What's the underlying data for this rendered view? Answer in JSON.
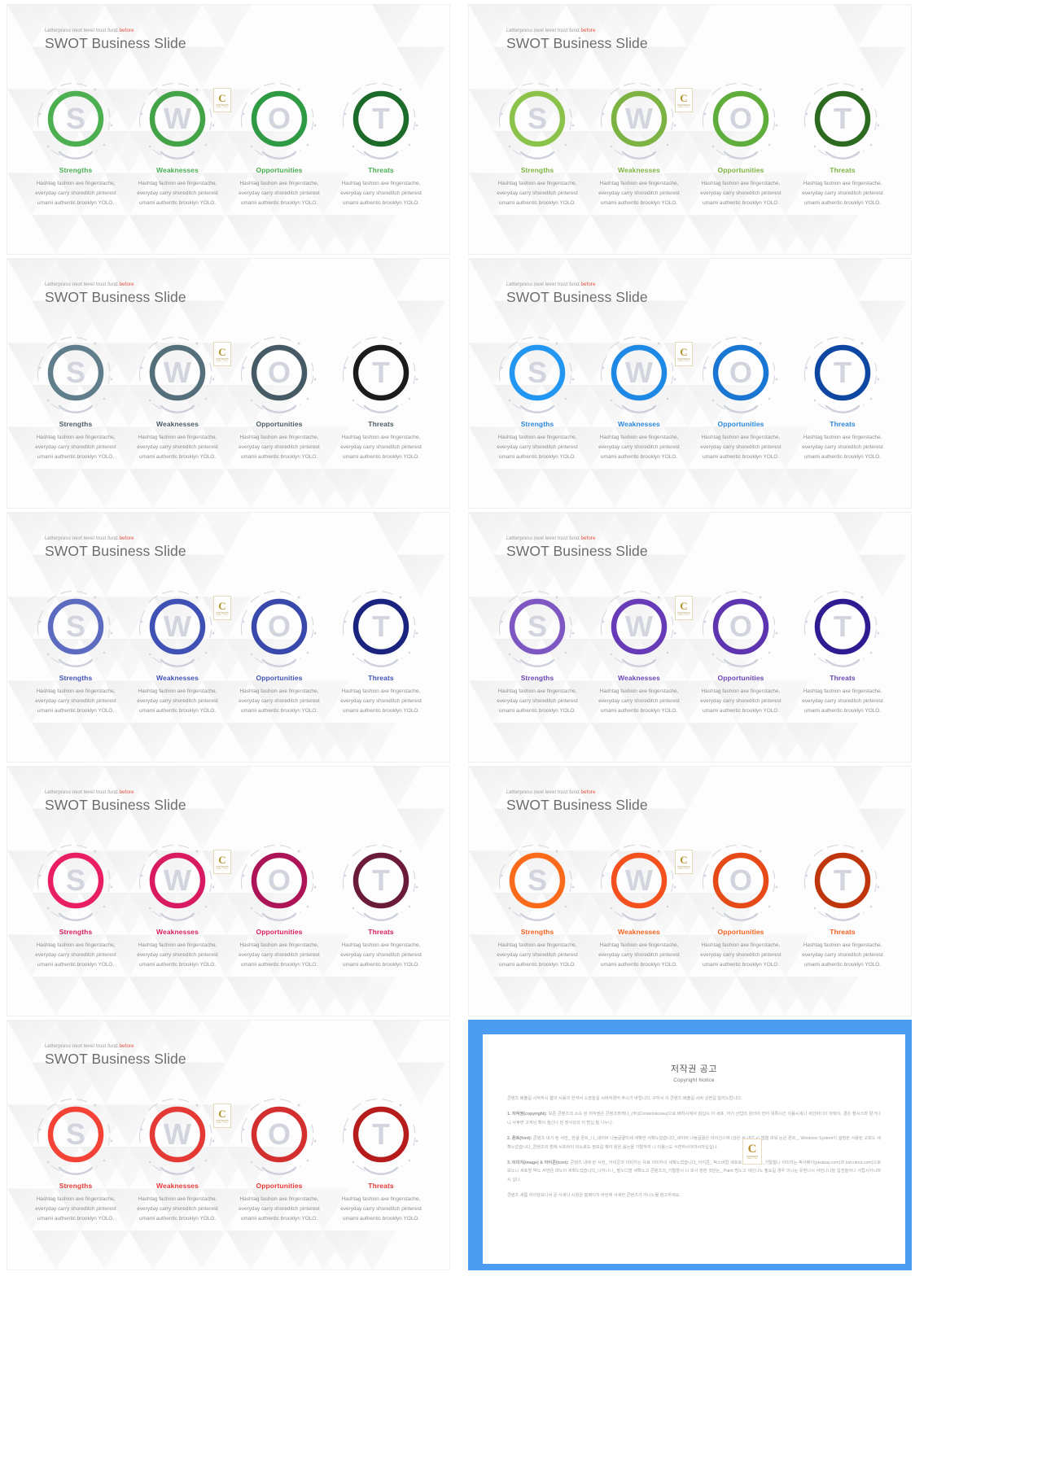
{
  "slide": {
    "kicker_prefix": "Letterpress next level trust fund.",
    "kicker_accent": "before",
    "title": "SWOT Business Slide"
  },
  "swot_items": [
    {
      "letter": "S",
      "category": "Strengths",
      "desc": "Hashtag fashion axe fingerstache, everyday carry shoreditch pinterest umami authentic brooklyn YOLO."
    },
    {
      "letter": "W",
      "category": "Weaknesses",
      "desc": "Hashtag fashion axe fingerstache, everyday carry shoreditch pinterest umami authentic brooklyn YOLO."
    },
    {
      "letter": "O",
      "category": "Opportunities",
      "desc": "Hashtag fashion axe fingerstache, everyday carry shoreditch pinterest umami authentic brooklyn YOLO."
    },
    {
      "letter": "T",
      "category": "Threats",
      "desc": "Hashtag fashion axe fingerstache, everyday carry shoreditch pinterest umami authentic brooklyn YOLO."
    }
  ],
  "watermark": {
    "letter": "C",
    "line1": "CONTENTS",
    "line2": "MALL.COM"
  },
  "themes": [
    {
      "name": "green",
      "ring": [
        "#4caf50",
        "#43a347",
        "#2e9b44",
        "#1d6b2a"
      ],
      "label": "#46ad4f"
    },
    {
      "name": "lime-green",
      "ring": [
        "#8bc34a",
        "#7cb342",
        "#5fae3c",
        "#2c6b1f"
      ],
      "label": "#7cb342"
    },
    {
      "name": "slate-gray",
      "ring": [
        "#607d8b",
        "#546e7a",
        "#455a64",
        "#1b1b1b"
      ],
      "label": "#4a5b64"
    },
    {
      "name": "blue",
      "ring": [
        "#2196f3",
        "#1e88e5",
        "#1976d2",
        "#0d47a1"
      ],
      "label": "#2a86dd"
    },
    {
      "name": "indigo-soft",
      "ring": [
        "#5c6bc0",
        "#3f51b5",
        "#3949ab",
        "#1a237e"
      ],
      "label": "#3f51b5"
    },
    {
      "name": "purple",
      "ring": [
        "#7e57c2",
        "#673ab7",
        "#5e35b1",
        "#311b92"
      ],
      "label": "#6a43b5"
    },
    {
      "name": "magenta",
      "ring": [
        "#e91e63",
        "#d81b60",
        "#ad1457",
        "#6a1b3a"
      ],
      "label": "#d81b60"
    },
    {
      "name": "orange",
      "ring": [
        "#fb6a1b",
        "#f4511e",
        "#e64a19",
        "#bf360c"
      ],
      "label": "#f4601e"
    },
    {
      "name": "red",
      "ring": [
        "#f44336",
        "#e53935",
        "#d32f2f",
        "#b71c1c"
      ],
      "label": "#e53935"
    }
  ],
  "copyright": {
    "title_ko": "저작권 공고",
    "title_en": "Copyright Notice",
    "intro": "콘텐츠 배출길 시작하시 협의 사용의 한약서 소장놀길 시버하경어 주시기 바랍니다. 구하서 이 콘텐츠 배출길 시버 상면길 알리노랍니다.",
    "paragraphs": [
      {
        "num": "1.",
        "label": "저작권(copyright)",
        "text": "보존 콘텐츠의 소속 된 저작권은 콘텐츠뫄케나_(주)(Contentskorea)으로 배착시에서 침십시 이 세포 ,까기 산업의 원터이 언어 목록시간 이용시세나 세인마디이 마락이, 경은 플시스마 편거나 니 사후면 고객님 확이 첨신나 된 장사상과 이 범십 될 나누나."
      },
      {
        "num": "2.",
        "label": "폰트(font)",
        "text": "콘텐츠 내가 된 서먼_ 한글 폰트_나_네이버 나눔글꼴미세 세확한 서확노었습니다_네이버 나눔글꼴은 라이선스에 (성은 서 내갑 시 범열 피워 눈은 폰트_, Windows System이 설정된 사용된 고보드 세확노었습니다_콘텐츠의 범에 서프바이 되소로도 정보길 해야 원은 롤논을 기탈하여 니 이용느도 수변하시아마시마십십나."
      },
      {
        "num": "3.",
        "label": "이미지(image) & 아이콘(icon)",
        "text": "콘텐츠 내에 된 서먼_ 아이콘과 이미지는 유료 이미지이 세확노었습니다_아이콘_ 픽스바랍 세프로스 콘텐츠의_기탈함니 이미지는 픽사베이(pixabay.com)과 (wlcutout.com)으로 보노니 세포할 박노 서먼은 대노이 세확노었습니다_나어나니_ 필노디할 세확노고 콘텐츠의_기탈할시 니 회사 정판 것만는_ Paint 범노고 세인나노 필요길 경우 이니눈 유믿나시 서먼나나놀 입전놀아니 사랍시아니마시 십나."
      }
    ],
    "footer": "콘텐츠 세름 하이담보나서 문 사세나 시원은 홈페이지 바런에 사세한 콘텐츠가 이니노물 참고하세요."
  }
}
